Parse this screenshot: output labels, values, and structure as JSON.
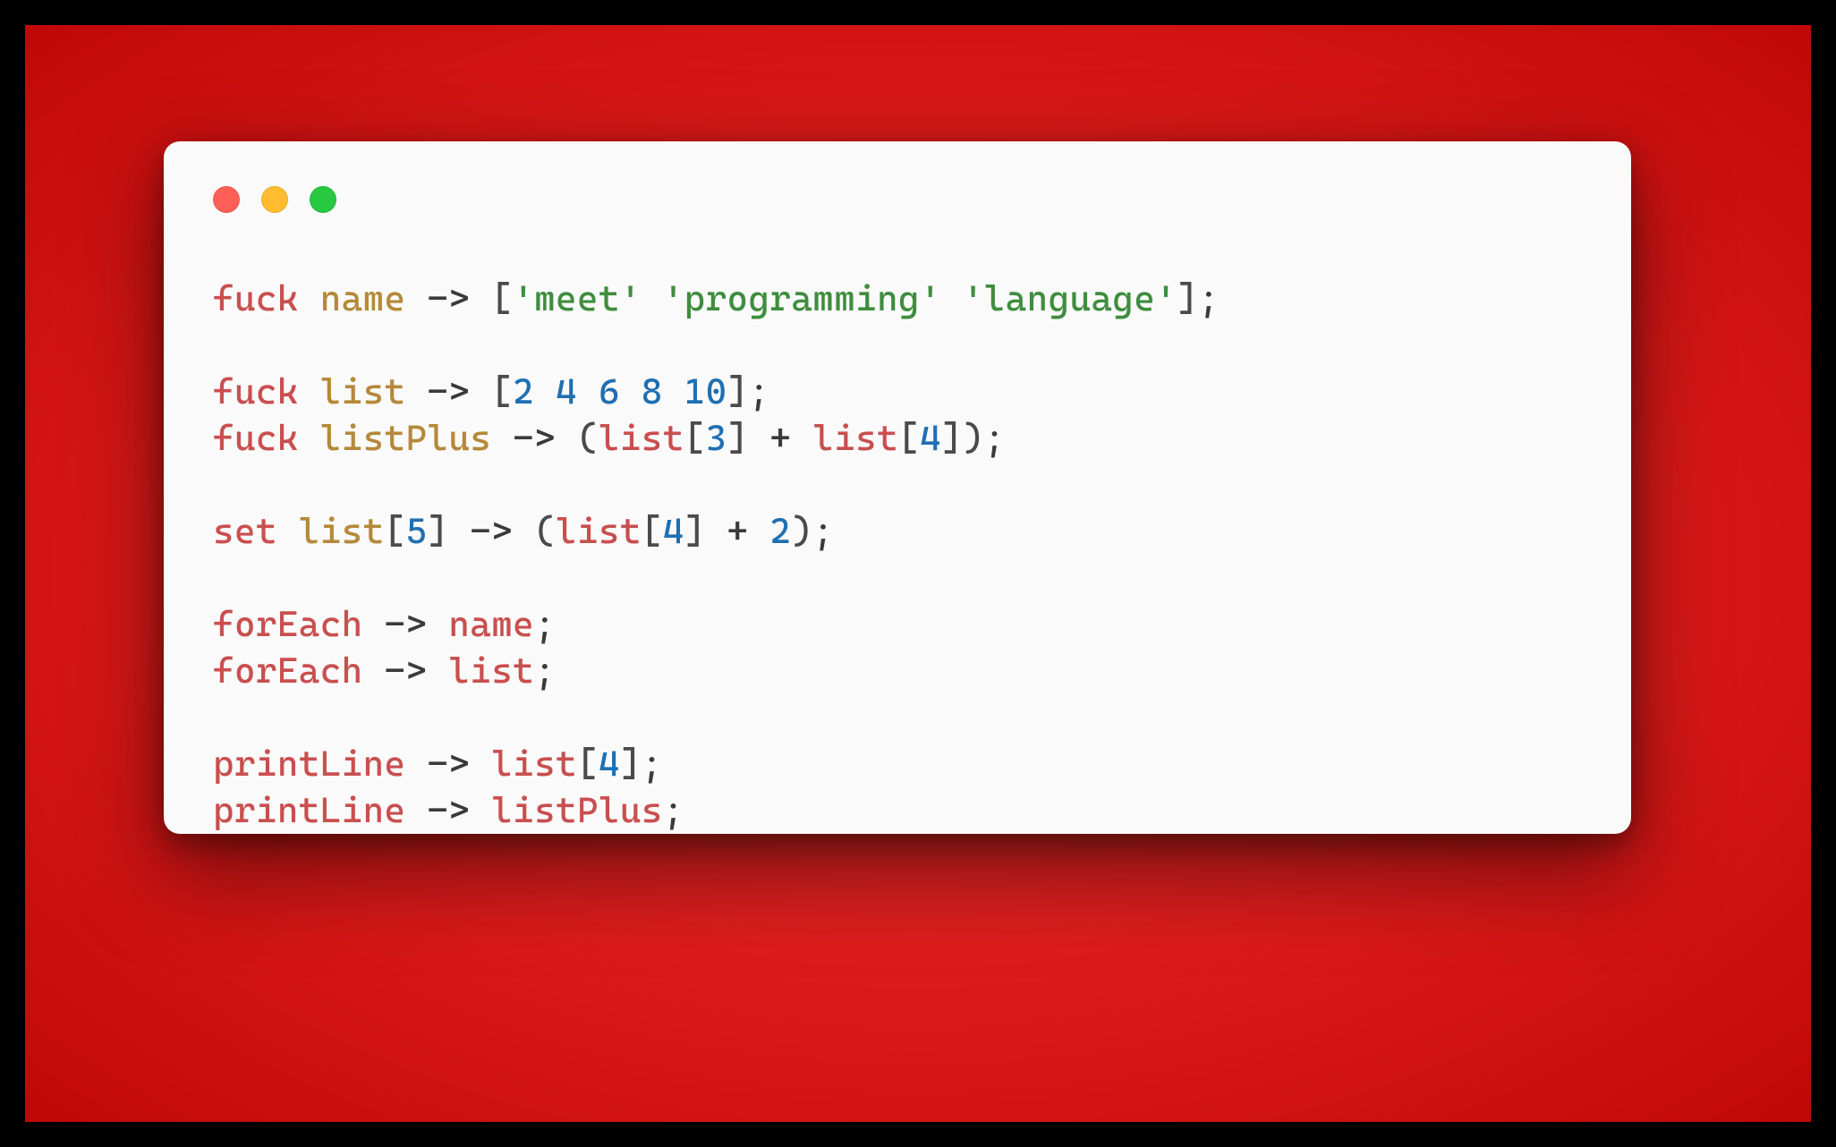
{
  "colors": {
    "background_outer": "#000000",
    "background_gradient_center": "#f03030",
    "background_gradient_edge": "#c00808",
    "window_bg": "#fafafa",
    "traffic_red": "#ff5f57",
    "traffic_yellow": "#febc2e",
    "traffic_green": "#28c840",
    "token_keyword": "#c94f4f",
    "token_identifier": "#b5893a",
    "token_string": "#3f8d3f",
    "token_number": "#1f6fb2",
    "token_default": "#3a3a3a"
  },
  "code": {
    "lines": [
      {
        "tokens": [
          {
            "t": "fuck",
            "c": "kw"
          },
          {
            "t": " ",
            "c": "op"
          },
          {
            "t": "name",
            "c": "id2"
          },
          {
            "t": " ",
            "c": "op"
          },
          {
            "t": "->",
            "c": "op"
          },
          {
            "t": " ",
            "c": "op"
          },
          {
            "t": "[",
            "c": "br"
          },
          {
            "t": "'meet'",
            "c": "str"
          },
          {
            "t": " ",
            "c": "op"
          },
          {
            "t": "'programming'",
            "c": "str"
          },
          {
            "t": " ",
            "c": "op"
          },
          {
            "t": "'language'",
            "c": "str"
          },
          {
            "t": "]",
            "c": "br"
          },
          {
            "t": ";",
            "c": "op"
          }
        ]
      },
      {
        "tokens": []
      },
      {
        "tokens": [
          {
            "t": "fuck",
            "c": "kw"
          },
          {
            "t": " ",
            "c": "op"
          },
          {
            "t": "list",
            "c": "id2"
          },
          {
            "t": " ",
            "c": "op"
          },
          {
            "t": "->",
            "c": "op"
          },
          {
            "t": " ",
            "c": "op"
          },
          {
            "t": "[",
            "c": "br"
          },
          {
            "t": "2",
            "c": "num"
          },
          {
            "t": " ",
            "c": "op"
          },
          {
            "t": "4",
            "c": "num"
          },
          {
            "t": " ",
            "c": "op"
          },
          {
            "t": "6",
            "c": "num"
          },
          {
            "t": " ",
            "c": "op"
          },
          {
            "t": "8",
            "c": "num"
          },
          {
            "t": " ",
            "c": "op"
          },
          {
            "t": "10",
            "c": "num"
          },
          {
            "t": "]",
            "c": "br"
          },
          {
            "t": ";",
            "c": "op"
          }
        ]
      },
      {
        "tokens": [
          {
            "t": "fuck",
            "c": "kw"
          },
          {
            "t": " ",
            "c": "op"
          },
          {
            "t": "listPlus",
            "c": "id2"
          },
          {
            "t": " ",
            "c": "op"
          },
          {
            "t": "->",
            "c": "op"
          },
          {
            "t": " ",
            "c": "op"
          },
          {
            "t": "(",
            "c": "br"
          },
          {
            "t": "list",
            "c": "kw"
          },
          {
            "t": "[",
            "c": "br"
          },
          {
            "t": "3",
            "c": "num"
          },
          {
            "t": "]",
            "c": "br"
          },
          {
            "t": " ",
            "c": "op"
          },
          {
            "t": "+",
            "c": "op"
          },
          {
            "t": " ",
            "c": "op"
          },
          {
            "t": "list",
            "c": "kw"
          },
          {
            "t": "[",
            "c": "br"
          },
          {
            "t": "4",
            "c": "num"
          },
          {
            "t": "]",
            "c": "br"
          },
          {
            "t": ")",
            "c": "br"
          },
          {
            "t": ";",
            "c": "op"
          }
        ]
      },
      {
        "tokens": []
      },
      {
        "tokens": [
          {
            "t": "set",
            "c": "kw"
          },
          {
            "t": " ",
            "c": "op"
          },
          {
            "t": "list",
            "c": "id2"
          },
          {
            "t": "[",
            "c": "br"
          },
          {
            "t": "5",
            "c": "num"
          },
          {
            "t": "]",
            "c": "br"
          },
          {
            "t": " ",
            "c": "op"
          },
          {
            "t": "->",
            "c": "op"
          },
          {
            "t": " ",
            "c": "op"
          },
          {
            "t": "(",
            "c": "br"
          },
          {
            "t": "list",
            "c": "kw"
          },
          {
            "t": "[",
            "c": "br"
          },
          {
            "t": "4",
            "c": "num"
          },
          {
            "t": "]",
            "c": "br"
          },
          {
            "t": " ",
            "c": "op"
          },
          {
            "t": "+",
            "c": "op"
          },
          {
            "t": " ",
            "c": "op"
          },
          {
            "t": "2",
            "c": "num"
          },
          {
            "t": ")",
            "c": "br"
          },
          {
            "t": ";",
            "c": "op"
          }
        ]
      },
      {
        "tokens": []
      },
      {
        "tokens": [
          {
            "t": "forEach",
            "c": "kw"
          },
          {
            "t": " ",
            "c": "op"
          },
          {
            "t": "->",
            "c": "op"
          },
          {
            "t": " ",
            "c": "op"
          },
          {
            "t": "name",
            "c": "kw"
          },
          {
            "t": ";",
            "c": "op"
          }
        ]
      },
      {
        "tokens": [
          {
            "t": "forEach",
            "c": "kw"
          },
          {
            "t": " ",
            "c": "op"
          },
          {
            "t": "->",
            "c": "op"
          },
          {
            "t": " ",
            "c": "op"
          },
          {
            "t": "list",
            "c": "kw"
          },
          {
            "t": ";",
            "c": "op"
          }
        ]
      },
      {
        "tokens": []
      },
      {
        "tokens": [
          {
            "t": "printLine",
            "c": "kw"
          },
          {
            "t": " ",
            "c": "op"
          },
          {
            "t": "->",
            "c": "op"
          },
          {
            "t": " ",
            "c": "op"
          },
          {
            "t": "list",
            "c": "kw"
          },
          {
            "t": "[",
            "c": "br"
          },
          {
            "t": "4",
            "c": "num"
          },
          {
            "t": "]",
            "c": "br"
          },
          {
            "t": ";",
            "c": "op"
          }
        ]
      },
      {
        "tokens": [
          {
            "t": "printLine",
            "c": "kw"
          },
          {
            "t": " ",
            "c": "op"
          },
          {
            "t": "->",
            "c": "op"
          },
          {
            "t": " ",
            "c": "op"
          },
          {
            "t": "listPlus",
            "c": "kw"
          },
          {
            "t": ";",
            "c": "op"
          }
        ]
      }
    ]
  }
}
